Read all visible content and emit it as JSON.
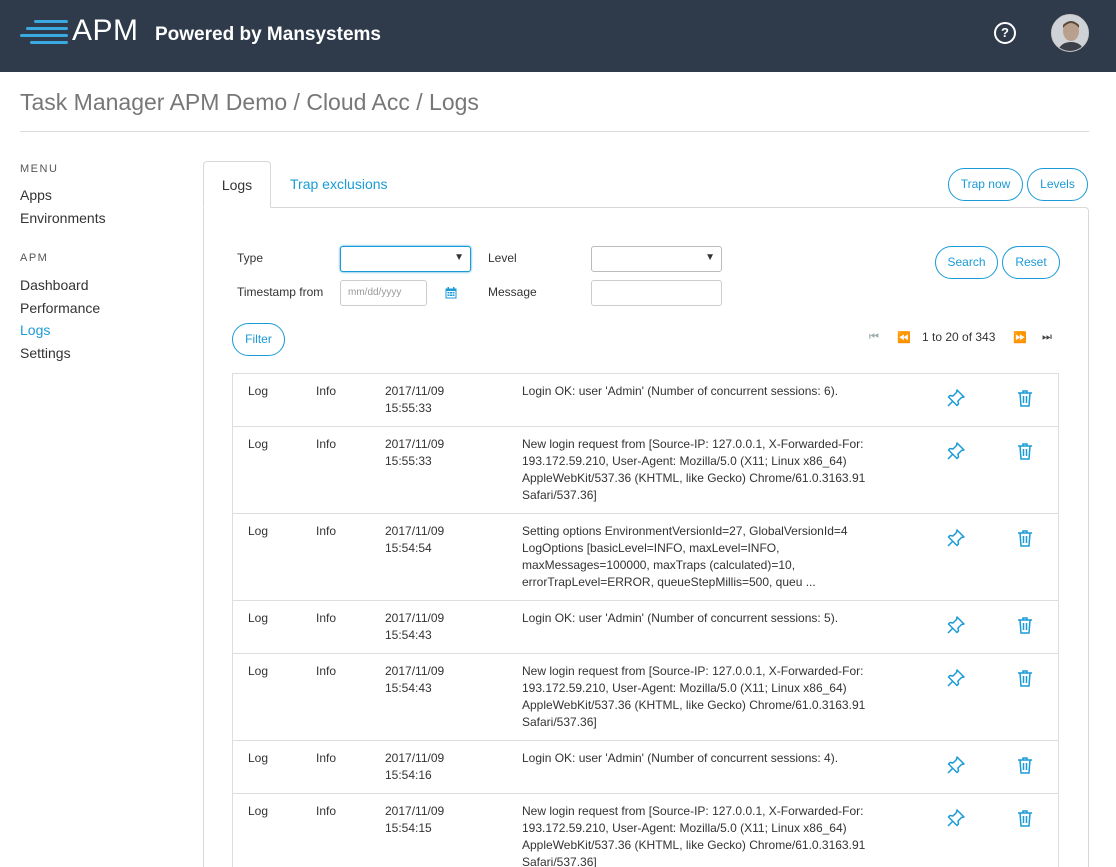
{
  "header": {
    "brand_name": "APM",
    "brand_subtitle": "Powered by Mansystems",
    "help_icon": "question-circle-icon",
    "help_glyph": "?",
    "avatar_icon": "user-avatar",
    "bg_color": "#2f3b4b",
    "accent_color": "#3aa9df"
  },
  "breadcrumb": "Task Manager APM Demo / Cloud Acc / Logs",
  "sidebar": {
    "menu_heading": "MENU",
    "menu_items": [
      {
        "label": "Apps"
      },
      {
        "label": "Environments"
      }
    ],
    "apm_heading": "APM",
    "apm_items": [
      {
        "label": "Dashboard"
      },
      {
        "label": "Performance"
      },
      {
        "label": "Logs",
        "active": true
      },
      {
        "label": "Settings"
      }
    ]
  },
  "tabs": [
    {
      "label": "Logs",
      "active": true
    },
    {
      "label": "Trap exclusions",
      "active": false
    }
  ],
  "actions": {
    "trap_now": "Trap now",
    "levels": "Levels",
    "search": "Search",
    "reset": "Reset",
    "filter": "Filter"
  },
  "filters": {
    "type_label": "Type",
    "type_value": "",
    "level_label": "Level",
    "level_value": "",
    "timestamp_label": "Timestamp from",
    "timestamp_placeholder": "mm/dd/yyyy",
    "message_label": "Message",
    "message_value": "",
    "calendar_icon": "calendar-icon",
    "dropdown_glyph": "▼"
  },
  "pagination": {
    "summary": "1 to 20 of 343",
    "first_glyph": "⏮",
    "prev_glyph": "⏪",
    "next_glyph": "⏩",
    "last_glyph": "⏭"
  },
  "logs": [
    {
      "type": "Log",
      "level": "Info",
      "date": "2017/11/09",
      "time": "15:55:33",
      "message": "Login OK: user 'Admin' (Number of concurrent sessions: 6)."
    },
    {
      "type": "Log",
      "level": "Info",
      "date": "2017/11/09",
      "time": "15:55:33",
      "message": "New login request from [Source-IP: 127.0.0.1, X-Forwarded-For: 193.172.59.210, User-Agent: Mozilla/5.0 (X11; Linux x86_64) AppleWebKit/537.36 (KHTML, like Gecko) Chrome/61.0.3163.91 Safari/537.36]"
    },
    {
      "type": "Log",
      "level": "Info",
      "date": "2017/11/09",
      "time": "15:54:54",
      "message": "Setting options EnvironmentVersionId=27, GlobalVersionId=4 LogOptions [basicLevel=INFO, maxLevel=INFO, maxMessages=100000, maxTraps (calculated)=10, errorTrapLevel=ERROR, queueStepMillis=500, queu ..."
    },
    {
      "type": "Log",
      "level": "Info",
      "date": "2017/11/09",
      "time": "15:54:43",
      "message": "Login OK: user 'Admin' (Number of concurrent sessions: 5)."
    },
    {
      "type": "Log",
      "level": "Info",
      "date": "2017/11/09",
      "time": "15:54:43",
      "message": "New login request from [Source-IP: 127.0.0.1, X-Forwarded-For: 193.172.59.210, User-Agent: Mozilla/5.0 (X11; Linux x86_64) AppleWebKit/537.36 (KHTML, like Gecko) Chrome/61.0.3163.91 Safari/537.36]"
    },
    {
      "type": "Log",
      "level": "Info",
      "date": "2017/11/09",
      "time": "15:54:16",
      "message": "Login OK: user 'Admin' (Number of concurrent sessions: 4)."
    },
    {
      "type": "Log",
      "level": "Info",
      "date": "2017/11/09",
      "time": "15:54:15",
      "message": "New login request from [Source-IP: 127.0.0.1, X-Forwarded-For: 193.172.59.210, User-Agent: Mozilla/5.0 (X11; Linux x86_64) AppleWebKit/537.36 (KHTML, like Gecko) Chrome/61.0.3163.91 Safari/537.36]"
    }
  ],
  "row_icons": {
    "pin": "pin-icon",
    "delete": "trash-icon"
  }
}
